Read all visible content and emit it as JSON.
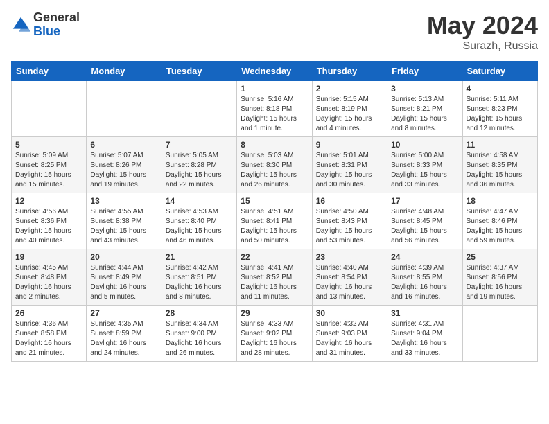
{
  "logo": {
    "general": "General",
    "blue": "Blue"
  },
  "title": {
    "month_year": "May 2024",
    "location": "Surazh, Russia"
  },
  "days_of_week": [
    "Sunday",
    "Monday",
    "Tuesday",
    "Wednesday",
    "Thursday",
    "Friday",
    "Saturday"
  ],
  "weeks": [
    [
      {
        "day": "",
        "info": ""
      },
      {
        "day": "",
        "info": ""
      },
      {
        "day": "",
        "info": ""
      },
      {
        "day": "1",
        "info": "Sunrise: 5:16 AM\nSunset: 8:18 PM\nDaylight: 15 hours\nand 1 minute."
      },
      {
        "day": "2",
        "info": "Sunrise: 5:15 AM\nSunset: 8:19 PM\nDaylight: 15 hours\nand 4 minutes."
      },
      {
        "day": "3",
        "info": "Sunrise: 5:13 AM\nSunset: 8:21 PM\nDaylight: 15 hours\nand 8 minutes."
      },
      {
        "day": "4",
        "info": "Sunrise: 5:11 AM\nSunset: 8:23 PM\nDaylight: 15 hours\nand 12 minutes."
      }
    ],
    [
      {
        "day": "5",
        "info": "Sunrise: 5:09 AM\nSunset: 8:25 PM\nDaylight: 15 hours\nand 15 minutes."
      },
      {
        "day": "6",
        "info": "Sunrise: 5:07 AM\nSunset: 8:26 PM\nDaylight: 15 hours\nand 19 minutes."
      },
      {
        "day": "7",
        "info": "Sunrise: 5:05 AM\nSunset: 8:28 PM\nDaylight: 15 hours\nand 22 minutes."
      },
      {
        "day": "8",
        "info": "Sunrise: 5:03 AM\nSunset: 8:30 PM\nDaylight: 15 hours\nand 26 minutes."
      },
      {
        "day": "9",
        "info": "Sunrise: 5:01 AM\nSunset: 8:31 PM\nDaylight: 15 hours\nand 30 minutes."
      },
      {
        "day": "10",
        "info": "Sunrise: 5:00 AM\nSunset: 8:33 PM\nDaylight: 15 hours\nand 33 minutes."
      },
      {
        "day": "11",
        "info": "Sunrise: 4:58 AM\nSunset: 8:35 PM\nDaylight: 15 hours\nand 36 minutes."
      }
    ],
    [
      {
        "day": "12",
        "info": "Sunrise: 4:56 AM\nSunset: 8:36 PM\nDaylight: 15 hours\nand 40 minutes."
      },
      {
        "day": "13",
        "info": "Sunrise: 4:55 AM\nSunset: 8:38 PM\nDaylight: 15 hours\nand 43 minutes."
      },
      {
        "day": "14",
        "info": "Sunrise: 4:53 AM\nSunset: 8:40 PM\nDaylight: 15 hours\nand 46 minutes."
      },
      {
        "day": "15",
        "info": "Sunrise: 4:51 AM\nSunset: 8:41 PM\nDaylight: 15 hours\nand 50 minutes."
      },
      {
        "day": "16",
        "info": "Sunrise: 4:50 AM\nSunset: 8:43 PM\nDaylight: 15 hours\nand 53 minutes."
      },
      {
        "day": "17",
        "info": "Sunrise: 4:48 AM\nSunset: 8:45 PM\nDaylight: 15 hours\nand 56 minutes."
      },
      {
        "day": "18",
        "info": "Sunrise: 4:47 AM\nSunset: 8:46 PM\nDaylight: 15 hours\nand 59 minutes."
      }
    ],
    [
      {
        "day": "19",
        "info": "Sunrise: 4:45 AM\nSunset: 8:48 PM\nDaylight: 16 hours\nand 2 minutes."
      },
      {
        "day": "20",
        "info": "Sunrise: 4:44 AM\nSunset: 8:49 PM\nDaylight: 16 hours\nand 5 minutes."
      },
      {
        "day": "21",
        "info": "Sunrise: 4:42 AM\nSunset: 8:51 PM\nDaylight: 16 hours\nand 8 minutes."
      },
      {
        "day": "22",
        "info": "Sunrise: 4:41 AM\nSunset: 8:52 PM\nDaylight: 16 hours\nand 11 minutes."
      },
      {
        "day": "23",
        "info": "Sunrise: 4:40 AM\nSunset: 8:54 PM\nDaylight: 16 hours\nand 13 minutes."
      },
      {
        "day": "24",
        "info": "Sunrise: 4:39 AM\nSunset: 8:55 PM\nDaylight: 16 hours\nand 16 minutes."
      },
      {
        "day": "25",
        "info": "Sunrise: 4:37 AM\nSunset: 8:56 PM\nDaylight: 16 hours\nand 19 minutes."
      }
    ],
    [
      {
        "day": "26",
        "info": "Sunrise: 4:36 AM\nSunset: 8:58 PM\nDaylight: 16 hours\nand 21 minutes."
      },
      {
        "day": "27",
        "info": "Sunrise: 4:35 AM\nSunset: 8:59 PM\nDaylight: 16 hours\nand 24 minutes."
      },
      {
        "day": "28",
        "info": "Sunrise: 4:34 AM\nSunset: 9:00 PM\nDaylight: 16 hours\nand 26 minutes."
      },
      {
        "day": "29",
        "info": "Sunrise: 4:33 AM\nSunset: 9:02 PM\nDaylight: 16 hours\nand 28 minutes."
      },
      {
        "day": "30",
        "info": "Sunrise: 4:32 AM\nSunset: 9:03 PM\nDaylight: 16 hours\nand 31 minutes."
      },
      {
        "day": "31",
        "info": "Sunrise: 4:31 AM\nSunset: 9:04 PM\nDaylight: 16 hours\nand 33 minutes."
      },
      {
        "day": "",
        "info": ""
      }
    ]
  ]
}
